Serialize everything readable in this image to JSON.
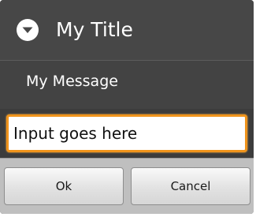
{
  "dialog": {
    "title": "My Title",
    "title_icon": "circle-chevron-down-icon",
    "message": "My Message",
    "input": {
      "value": "Input goes here",
      "placeholder": ""
    },
    "buttons": {
      "ok_label": "Ok",
      "cancel_label": "Cancel"
    },
    "colors": {
      "background": "#474747",
      "focus_border": "#f0941c",
      "button_bar": "#bfbfbf"
    }
  }
}
